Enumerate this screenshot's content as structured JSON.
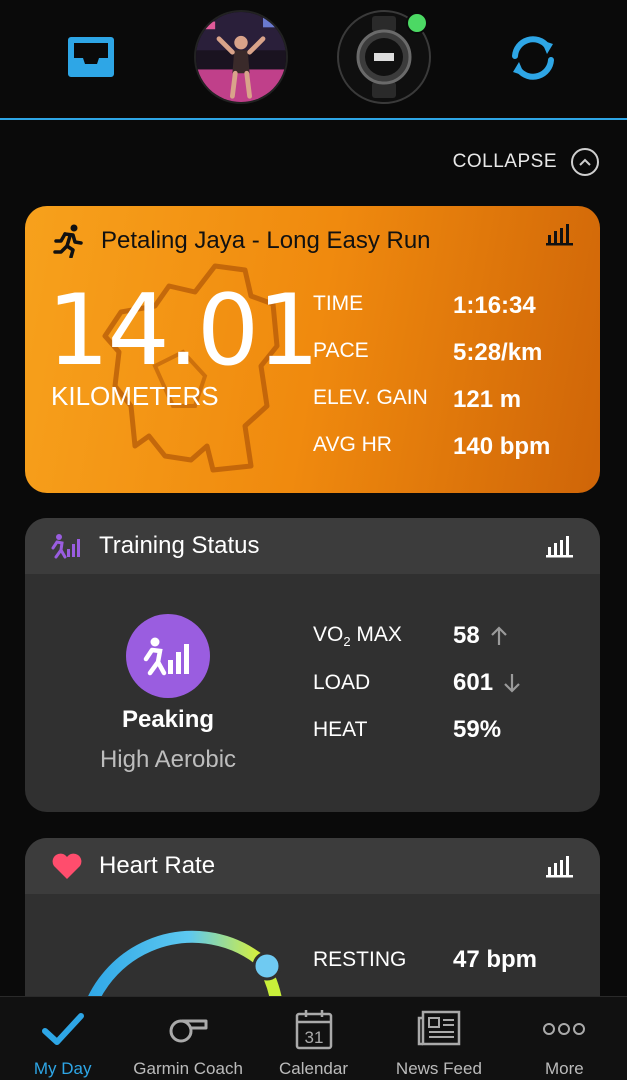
{
  "header": {
    "icons": [
      "inbox-icon",
      "profile-avatar",
      "watch-device",
      "sync-icon"
    ],
    "accent": "#2ea6e6",
    "device_connected_color": "#4cd964"
  },
  "collapse": {
    "label": "COLLAPSE"
  },
  "activity": {
    "title": "Petaling Jaya - Long Easy Run",
    "distance": "14.01",
    "unit": "KILOMETERS",
    "stats": [
      {
        "label": "TIME",
        "value": "1:16:34"
      },
      {
        "label": "PACE",
        "value": "5:28/km"
      },
      {
        "label": "ELEV. GAIN",
        "value": "121 m"
      },
      {
        "label": "AVG HR",
        "value": "140 bpm"
      }
    ],
    "color": "#f39314"
  },
  "training_status": {
    "title": "Training Status",
    "status": "Peaking",
    "sub": "High Aerobic",
    "vo2_label_main": "VO",
    "vo2_label_sub": "2",
    "vo2_label_tail": " MAX",
    "vo2_value": "58",
    "vo2_trend": "up",
    "load_label": "LOAD",
    "load_value": "601",
    "load_trend": "down",
    "heat_label": "HEAT",
    "heat_value": "59%",
    "color": "#9a5de0"
  },
  "heart_rate": {
    "title": "Heart Rate",
    "resting_label": "RESTING",
    "resting_value": "47 bpm",
    "color": "#ff4d6d"
  },
  "bottom_nav": {
    "items": [
      {
        "label": "My Day",
        "icon": "check-icon",
        "active": true
      },
      {
        "label": "Garmin Coach",
        "icon": "whistle-icon",
        "active": false
      },
      {
        "label": "Calendar",
        "icon": "calendar-icon",
        "active": false,
        "calendar_day": "31"
      },
      {
        "label": "News Feed",
        "icon": "newspaper-icon",
        "active": false
      },
      {
        "label": "More",
        "icon": "more-icon",
        "active": false
      }
    ]
  }
}
